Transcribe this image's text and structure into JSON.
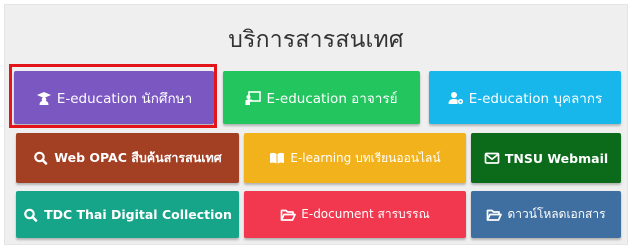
{
  "panel": {
    "title": "บริการสารสนเทศ"
  },
  "buttons": {
    "student": {
      "label": "E-education นักศึกษา",
      "icon": "graduate-icon",
      "color": "#7b57c2"
    },
    "teacher": {
      "label": "E-education อาจารย์",
      "icon": "teacher-board-icon",
      "color": "#22c55e"
    },
    "staff": {
      "label": "E-education บุคลากร",
      "icon": "user-gear-icon",
      "color": "#17b7eb"
    },
    "opac": {
      "label": "Web OPAC สืบค้นสารสนเทศ",
      "icon": "search-icon",
      "color": "#a33f23"
    },
    "elearning": {
      "label": "E-learning บทเรียนออนไลน์",
      "icon": "book-icon",
      "color": "#f2b21b"
    },
    "webmail": {
      "label": "TNSU Webmail",
      "icon": "envelope-icon",
      "color": "#0b6b1b"
    },
    "tdc": {
      "label": "TDC Thai Digital Collection",
      "icon": "search-icon",
      "color": "#17a589"
    },
    "edocument": {
      "label": "E-document สารบรรณ",
      "icon": "folder-open-icon",
      "color": "#f2384f"
    },
    "download": {
      "label": "ดาวน์โหลดเอกสาร",
      "icon": "folder-open-icon",
      "color": "#3f6fa1"
    }
  }
}
